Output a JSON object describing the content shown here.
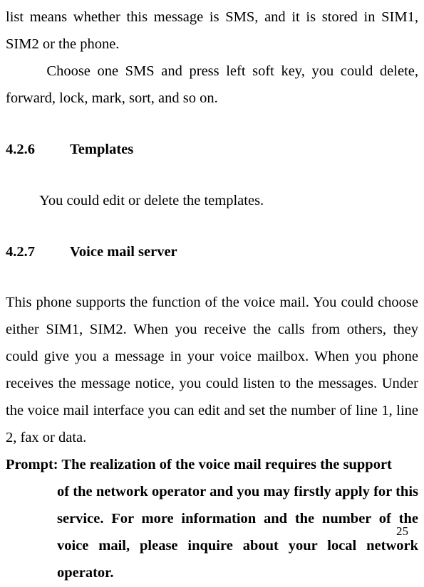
{
  "intro": {
    "line1": "list means whether this message is SMS, and it is stored in SIM1, SIM2 or the phone.",
    "line2": "Choose one SMS and press left soft key, you could delete, forward, lock, mark, sort, and so on."
  },
  "section1": {
    "number": "4.2.6",
    "title": "Templates",
    "body": "You could edit or delete the templates."
  },
  "section2": {
    "number": "4.2.7",
    "title": "Voice mail server",
    "body": "This phone supports the function of the voice mail. You could choose either SIM1, SIM2. When you receive the calls from others, they could give you a message in your voice mailbox. When you phone receives the message notice, you could listen to the messages. Under the voice mail interface you can edit and set the number of line 1, line 2, fax or data."
  },
  "prompt": {
    "label": "Prompt: ",
    "firstline": "The realization of the voice mail requires the support",
    "rest": "of the network operator and you may firstly apply for this service. For more information and the number of the voice mail, please inquire about your local network operator."
  },
  "page_number": "25"
}
